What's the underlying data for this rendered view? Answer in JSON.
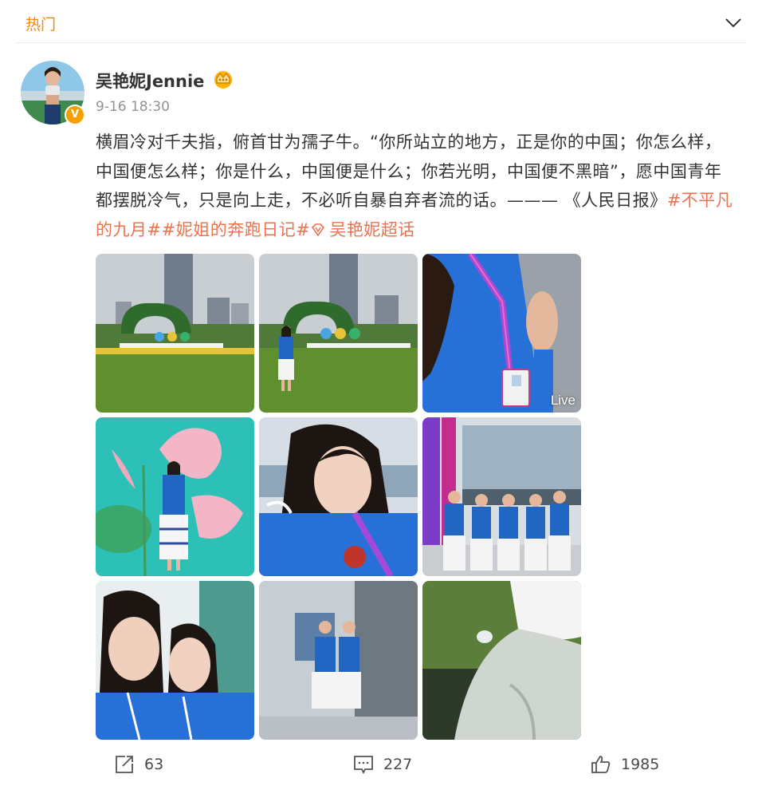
{
  "topbar": {
    "tab_label": "热门",
    "expand_icon": "chevron-down-icon",
    "accent_color": "#ff8200"
  },
  "post": {
    "author": "吴艳妮Jennie",
    "verified_badge": "V",
    "vip_icon": "vip-crown-icon",
    "timestamp": "9-16 18:30",
    "text_main": "横眉冷对千夫指，俯首甘为孺子牛。“你所站立的地方，正是你的中国；你怎么样，中国便怎么样；你是什么，中国便是什么；你若光明，中国便不黑暗”，愿中国青年都摆脱冷气，只是向上走，不必听自暴自弃者流的话。——— 《人民日报》",
    "hashtags": [
      "#不平凡的九月#",
      "#妮姐的奔跑日记#",
      "吴艳妮超话"
    ],
    "hashtag_color": "#eb7350",
    "supertopic_icon": "diamond-icon",
    "images": [
      {
        "alt": "photo-1"
      },
      {
        "alt": "photo-2"
      },
      {
        "alt": "photo-3",
        "badge": "Live"
      },
      {
        "alt": "photo-4"
      },
      {
        "alt": "photo-5"
      },
      {
        "alt": "photo-6"
      },
      {
        "alt": "photo-7"
      },
      {
        "alt": "photo-8"
      },
      {
        "alt": "photo-9"
      }
    ]
  },
  "actions": {
    "repost": {
      "icon": "share-icon",
      "count": "63"
    },
    "comment": {
      "icon": "comment-icon",
      "count": "227"
    },
    "like": {
      "icon": "thumbs-up-icon",
      "count": "1985"
    }
  }
}
